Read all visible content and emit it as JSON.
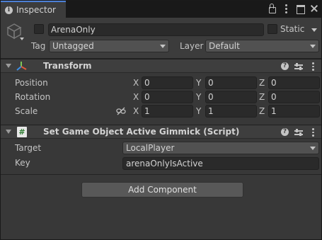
{
  "window": {
    "tab_title": "Inspector"
  },
  "header": {
    "name_value": "ArenaOnly",
    "static_label": "Static",
    "tag_label": "Tag",
    "tag_value": "Untagged",
    "layer_label": "Layer",
    "layer_value": "Default"
  },
  "transform": {
    "title": "Transform",
    "position_label": "Position",
    "rotation_label": "Rotation",
    "scale_label": "Scale",
    "axis_x": "X",
    "axis_y": "Y",
    "axis_z": "Z",
    "position": {
      "x": "0",
      "y": "0",
      "z": "0"
    },
    "rotation": {
      "x": "0",
      "y": "0",
      "z": "0"
    },
    "scale": {
      "x": "1",
      "y": "1",
      "z": "1"
    }
  },
  "script": {
    "title": "Set Game Object Active Gimmick (Script)",
    "icon_text": "#",
    "target_label": "Target",
    "target_value": "LocalPlayer",
    "key_label": "Key",
    "key_value": "arenaOnlyIsActive"
  },
  "footer": {
    "add_component_label": "Add Component"
  },
  "icons": {
    "tab": "info-icon",
    "lock": "lock-icon",
    "tab_menu": "kebab-icon",
    "maximize": "maximize-icon",
    "close": "close-icon",
    "gameobject": "cube-icon",
    "transform": "transform-axes-icon",
    "help": "help-icon",
    "presets": "presets-icon",
    "context_menu": "context-menu-icon",
    "link": "unlinked-scale-icon",
    "script": "script-icon"
  },
  "colors": {
    "window_bg": "#383838",
    "header_bg": "#3c3c3c",
    "field_bg": "#2a2a2a",
    "dropdown_bg": "#515151",
    "tab_accent": "#4c7fd6",
    "text": "#c4c4c4"
  }
}
